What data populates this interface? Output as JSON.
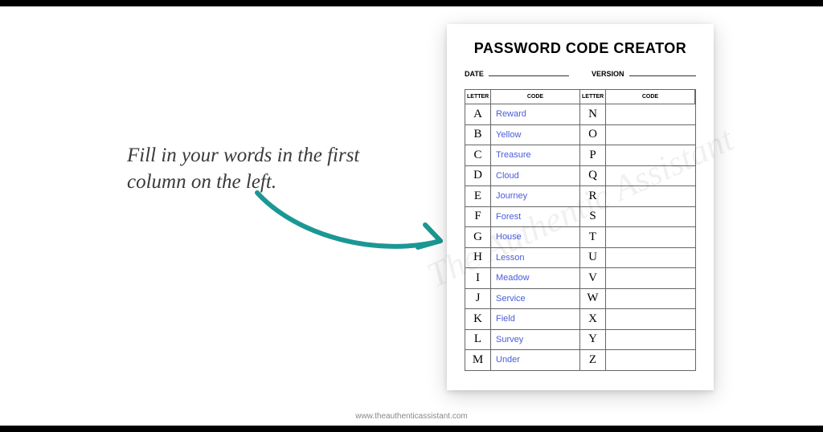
{
  "instruction": "Fill in your words in the first column on the left.",
  "paper": {
    "title": "PASSWORD CODE CREATOR",
    "date_label": "DATE",
    "version_label": "VERSION",
    "headers": {
      "letter": "LETTER",
      "code": "CODE"
    },
    "rows": [
      {
        "l1": "A",
        "c1": "Reward",
        "l2": "N",
        "c2": ""
      },
      {
        "l1": "B",
        "c1": "Yellow",
        "l2": "O",
        "c2": ""
      },
      {
        "l1": "C",
        "c1": "Treasure",
        "l2": "P",
        "c2": ""
      },
      {
        "l1": "D",
        "c1": "Cloud",
        "l2": "Q",
        "c2": ""
      },
      {
        "l1": "E",
        "c1": "Journey",
        "l2": "R",
        "c2": ""
      },
      {
        "l1": "F",
        "c1": "Forest",
        "l2": "S",
        "c2": ""
      },
      {
        "l1": "G",
        "c1": "House",
        "l2": "T",
        "c2": ""
      },
      {
        "l1": "H",
        "c1": "Lesson",
        "l2": "U",
        "c2": ""
      },
      {
        "l1": "I",
        "c1": "Meadow",
        "l2": "V",
        "c2": ""
      },
      {
        "l1": "J",
        "c1": "Service",
        "l2": "W",
        "c2": ""
      },
      {
        "l1": "K",
        "c1": "Field",
        "l2": "X",
        "c2": ""
      },
      {
        "l1": "L",
        "c1": "Survey",
        "l2": "Y",
        "c2": ""
      },
      {
        "l1": "M",
        "c1": "Under",
        "l2": "Z",
        "c2": ""
      }
    ]
  },
  "watermark": "The Authentic Assistant",
  "footer_url": "www.theauthenticassistant.com"
}
